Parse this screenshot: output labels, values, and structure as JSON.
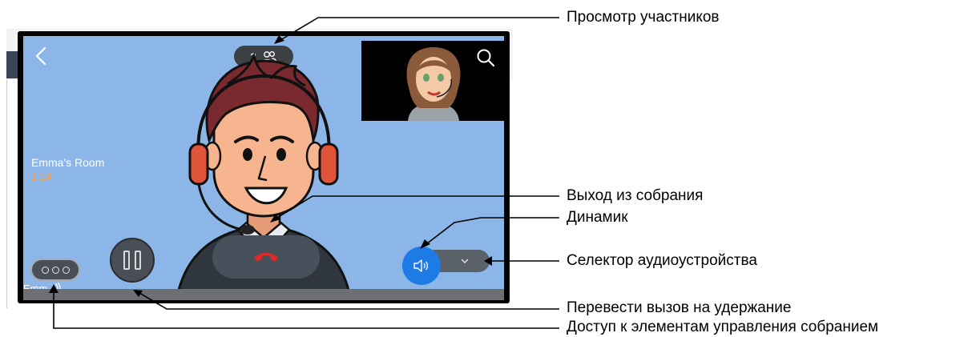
{
  "call": {
    "participant_count": "2",
    "room_name": "Emma's Room",
    "elapsed_time": "1:14",
    "caller_label": "Emm"
  },
  "icons": {
    "back": "chevron-left-icon",
    "participants": "people-icon",
    "search": "search-icon",
    "end_call": "phone-hangup-icon",
    "hold": "pause-icon",
    "more": "more-dots-icon",
    "speaker": "speaker-icon",
    "audio_selector": "chevron-down-icon"
  },
  "colors": {
    "screen_bg": "#8db6e8",
    "time_text": "#f5a04a",
    "end_call_icon": "#e32626",
    "speaker_button": "#1e7be6"
  },
  "annotations": {
    "participants_view": "Просмотр участников",
    "leave_meeting": "Выход из собрания",
    "speaker": "Динамик",
    "audio_selector": "Селектор аудиоустройства",
    "hold_call": "Перевести вызов на удержание",
    "meeting_controls": "Доступ к элементам управления собранием"
  }
}
